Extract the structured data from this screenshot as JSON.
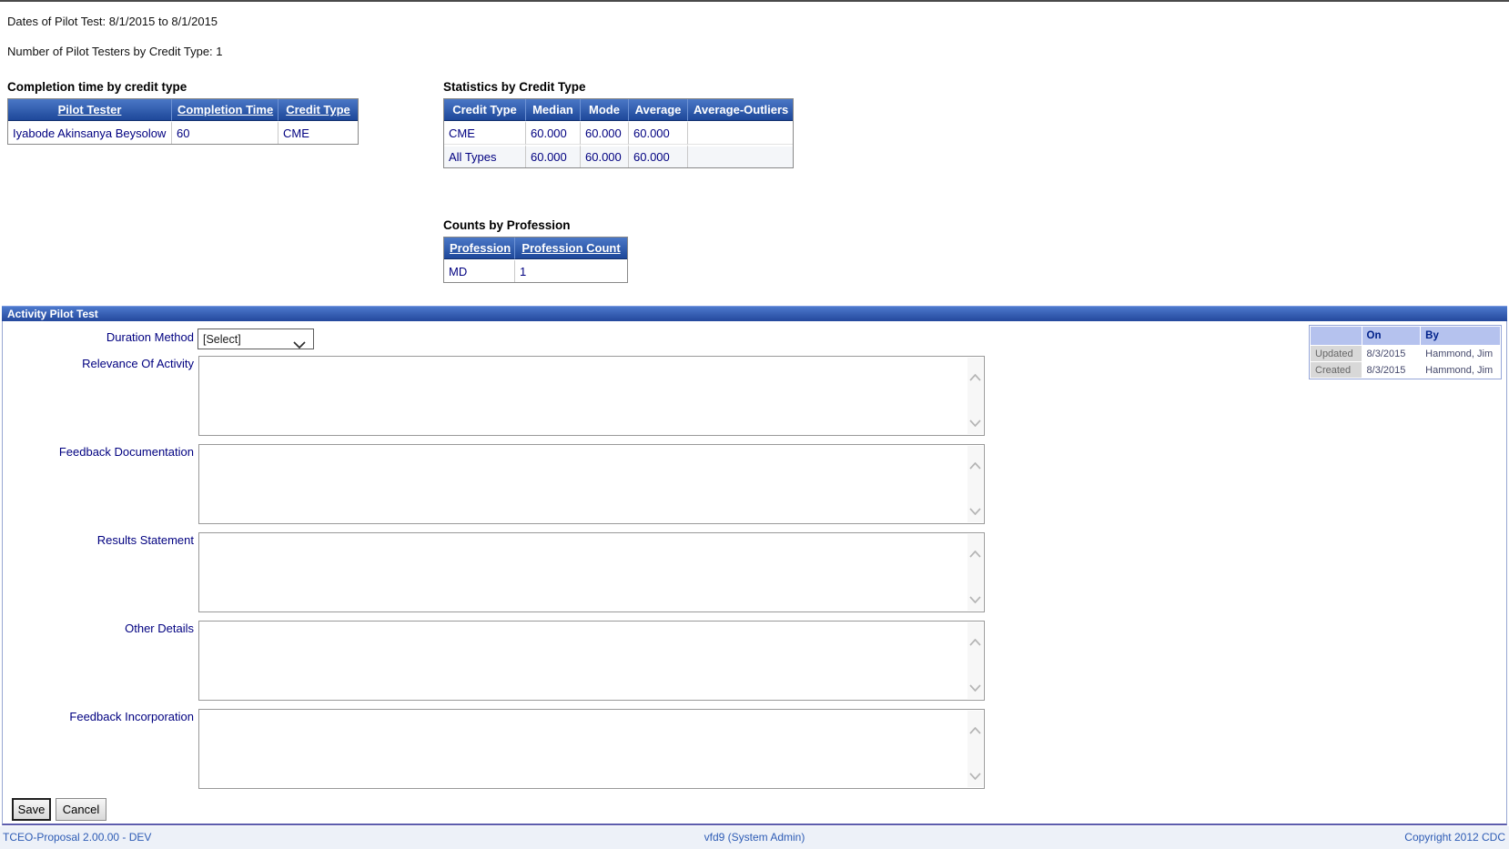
{
  "page": {
    "dates_line": "Dates of Pilot Test: 8/1/2015 to 8/1/2015",
    "testers_line": "Number of Pilot Testers by Credit Type: 1"
  },
  "completion_table": {
    "title": "Completion time by credit type",
    "headers": [
      "Pilot Tester",
      "Completion Time",
      "Credit Type"
    ],
    "rows": [
      [
        "Iyabode Akinsanya Beysolow",
        "60",
        "CME"
      ]
    ]
  },
  "statistics_table": {
    "title": "Statistics by Credit Type",
    "headers": [
      "Credit Type",
      "Median",
      "Mode",
      "Average",
      "Average-Outliers"
    ],
    "rows": [
      [
        "CME",
        "60.000",
        "60.000",
        "60.000",
        ""
      ],
      [
        "All Types",
        "60.000",
        "60.000",
        "60.000",
        ""
      ]
    ]
  },
  "profession_table": {
    "title": "Counts by Profession",
    "headers": [
      "Profession",
      "Profession Count"
    ],
    "rows": [
      [
        "MD",
        "1"
      ]
    ]
  },
  "panel": {
    "title": "Activity Pilot Test",
    "duration_method": {
      "label": "Duration Method",
      "value": "[Select]"
    },
    "textareas": [
      {
        "label": "Relevance Of Activity",
        "value": ""
      },
      {
        "label": "Feedback Documentation",
        "value": ""
      },
      {
        "label": "Results Statement",
        "value": ""
      },
      {
        "label": "Other Details",
        "value": ""
      },
      {
        "label": "Feedback Incorporation",
        "value": ""
      }
    ],
    "audit_table": {
      "headers": [
        "",
        "On",
        "By"
      ],
      "rows": [
        [
          "Updated",
          "8/3/2015",
          "Hammond, Jim"
        ],
        [
          "Created",
          "8/3/2015",
          "Hammond, Jim"
        ]
      ]
    },
    "buttons": {
      "save": "Save",
      "cancel": "Cancel"
    }
  },
  "footer": {
    "left": "TCEO-Proposal 2.00.00 - DEV",
    "center": "vfd9 (System Admin)",
    "right": "Copyright 2012 CDC"
  },
  "icons": {
    "select_chevron": "chevron-down-icon",
    "scroll_up": "scroll-up-icon",
    "scroll_down": "scroll-down-icon"
  },
  "colors": {
    "table_header_top": "#4a77c6",
    "table_header_bottom": "#1e489a",
    "navy_text": "#000080",
    "audit_header_bg": "#b5c2ee",
    "audit_label_bg": "#d8d8d8",
    "footer_bg": "#edf1f8",
    "footer_text": "#2e5cb5",
    "panel_border": "#97a6d2"
  }
}
